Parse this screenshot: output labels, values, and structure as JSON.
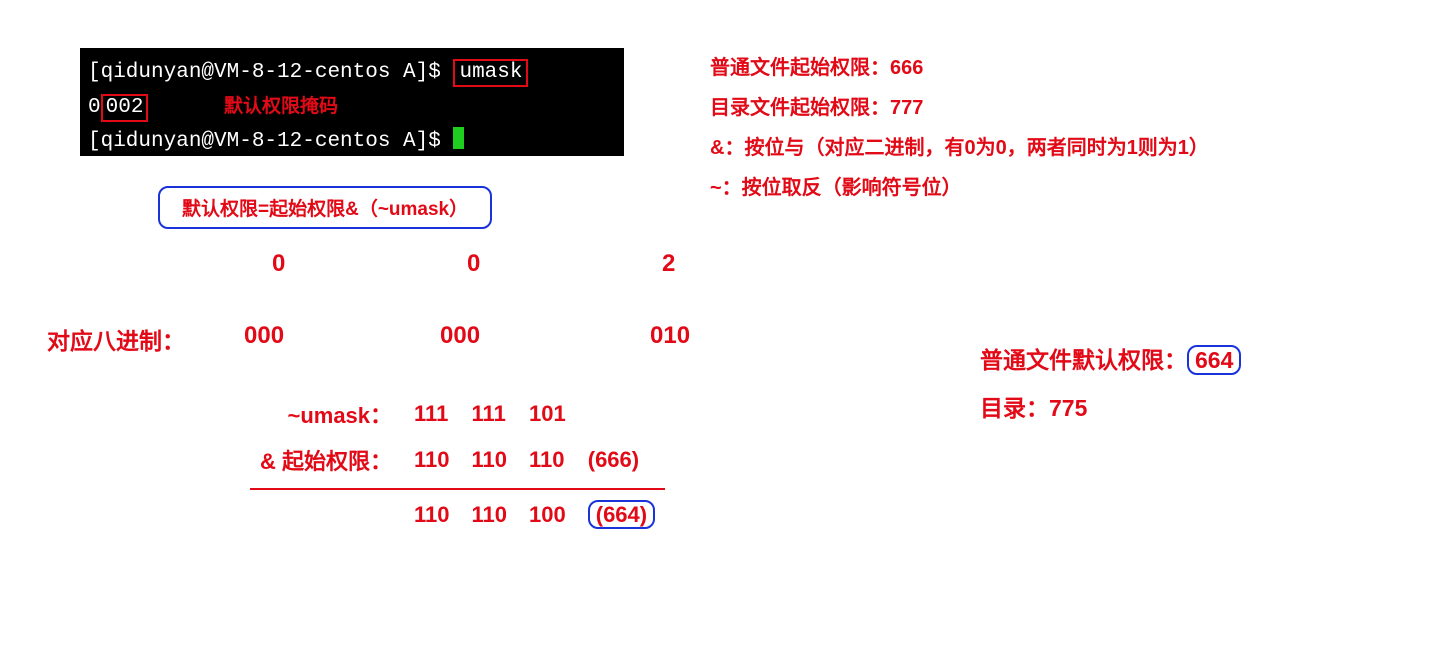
{
  "terminal": {
    "prompt1": "[qidunyan@VM-8-12-centos A]$ ",
    "cmd": "umask",
    "output_prefix": "0",
    "output_boxed": "002",
    "mask_label": "默认权限掩码",
    "prompt2": "[qidunyan@VM-8-12-centos A]$ "
  },
  "formula": "默认权限=起始权限&（~umask）",
  "digits": {
    "d1": "0",
    "d2": "0",
    "d3": "2"
  },
  "octal": {
    "label": "对应八进制：",
    "g1": "000",
    "g2": "000",
    "g3": "010"
  },
  "calc": {
    "row1_label": "~umask：",
    "row1_b1": "111",
    "row1_b2": "111",
    "row1_b3": "101",
    "row2_prefix": "&",
    "row2_label": "起始权限：",
    "row2_b1": "110",
    "row2_b2": "110",
    "row2_b3": "110",
    "row2_paren": "(666)",
    "res_b1": "110",
    "res_b2": "110",
    "res_b3": "100",
    "res_paren": "(664)"
  },
  "notes": {
    "l1": "普通文件起始权限：666",
    "l2": "目录文件起始权限：777",
    "l3": "&：按位与（对应二进制，有0为0，两者同时为1则为1）",
    "l4": "~：按位取反（影响符号位）"
  },
  "results": {
    "file_label": "普通文件默认权限：",
    "file_val": "664",
    "dir": "目录：775"
  }
}
